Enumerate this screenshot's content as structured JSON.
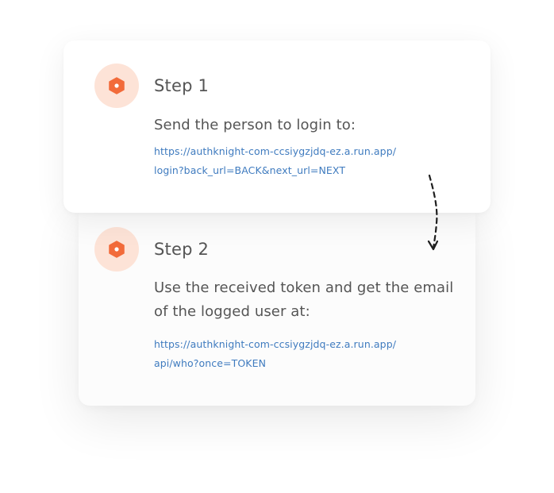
{
  "steps": [
    {
      "icon": "hexagon-icon",
      "title": "Step 1",
      "description": "Send the person to login to:",
      "link_line1": "https://authknight-com-ccsiygzjdq-ez.a.run.app/",
      "link_line2": "login?back_url=BACK&next_url=NEXT"
    },
    {
      "icon": "hexagon-icon",
      "title": "Step 2",
      "description": "Use the received token and get the email of the logged user at:",
      "link_line1": "https://authknight-com-ccsiygzjdq-ez.a.run.app/",
      "link_line2": "api/who?once=TOKEN"
    }
  ],
  "colors": {
    "accent": "#f26b3a",
    "badge_bg": "#fde3d7",
    "link": "#3f7bbf",
    "text": "#555555"
  }
}
